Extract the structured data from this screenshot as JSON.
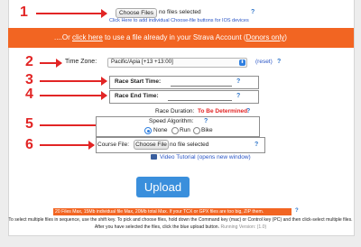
{
  "upload_section": {
    "file_button": "Choose Files",
    "file_status": "no files selected",
    "ios_link": "Click Here to add individual Choose-file buttons for IOS devices"
  },
  "banner": {
    "prefix": "....Or ",
    "link": "click here",
    "middle": " to use a file already in your Strava Account (",
    "donors": "Donors only",
    "suffix": ")"
  },
  "timezone": {
    "label": "Time Zone:",
    "selected": "Pacific/Apia [+13 +13:00]",
    "reset": "(reset)"
  },
  "race": {
    "start_label": "Race Start Time:",
    "end_label": "Race End Time:",
    "duration_label": "Race Duration:",
    "duration_value": "To Be Determined",
    "duration_qmark": "?"
  },
  "speed": {
    "label": "Speed Algorithm:",
    "qmark": "?",
    "options": [
      "None",
      "Run",
      "Bike"
    ],
    "selected": "None"
  },
  "course": {
    "label": "Course File:",
    "button": "Choose File",
    "status": "no file selected"
  },
  "video": {
    "label": "Video Tutorial (opens new window)"
  },
  "upload_button": "Upload",
  "limits": {
    "highlight": "20 Files Max, 15Mb individual file Max, 20Mb total Max. If your TCX or GPX files are too big, ZIP them.",
    "qmark": "?"
  },
  "instructions": {
    "text": "To select multiple files in sequence, use the shift key. To pick and choose files, hold down the Command key (mac) or Control key (PC) and then click-select multiple files. After you have selected the files, click the blue upload button.",
    "version": "Running Version: (1.0)"
  },
  "markers": [
    "1",
    "2",
    "3",
    "4",
    "5",
    "6"
  ],
  "qmark": "?",
  "colors": {
    "accent_orange": "#f26522",
    "upload_blue": "#3a8fdc",
    "annotation_red": "#e22525",
    "link_blue": "#2b73c9"
  }
}
